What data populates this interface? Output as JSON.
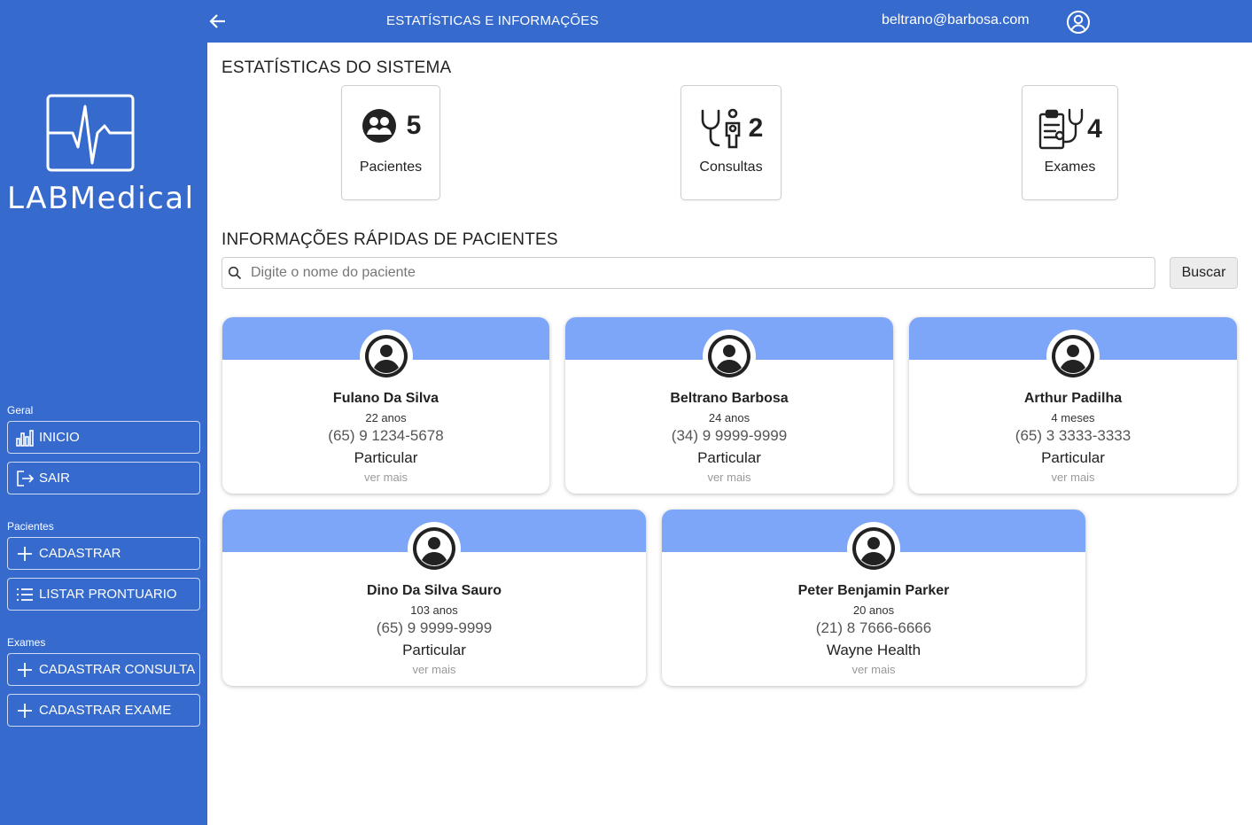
{
  "app": {
    "brand": "LABMedical"
  },
  "topbar": {
    "title": "ESTATÍSTICAS E INFORMAÇÕES",
    "email": "beltrano@barbosa.com"
  },
  "sidebar": {
    "sections": [
      {
        "label": "Geral",
        "items": [
          {
            "label": "INICIO",
            "icon": "bar-chart-icon"
          },
          {
            "label": "SAIR",
            "icon": "logout-icon"
          }
        ]
      },
      {
        "label": "Pacientes",
        "items": [
          {
            "label": "CADASTRAR",
            "icon": "plus-icon"
          },
          {
            "label": "LISTAR PRONTUARIO",
            "icon": "list-icon"
          }
        ]
      },
      {
        "label": "Exames",
        "items": [
          {
            "label": "CADASTRAR CONSULTA",
            "icon": "plus-icon"
          },
          {
            "label": "CADASTRAR EXAME",
            "icon": "plus-icon"
          }
        ]
      }
    ]
  },
  "stats": {
    "heading": "ESTATÍSTICAS DO SISTEMA",
    "items": [
      {
        "value": "5",
        "label": "Pacientes",
        "icon": "patients-icon"
      },
      {
        "value": "2",
        "label": "Consultas",
        "icon": "doctor-stethoscope-icon"
      },
      {
        "value": "4",
        "label": "Exames",
        "icon": "clipboard-stethoscope-icon"
      }
    ]
  },
  "quick": {
    "heading": "INFORMAÇÕES RÁPIDAS DE PACIENTES",
    "search_placeholder": "Digite o nome do paciente",
    "search_button": "Buscar"
  },
  "patients": [
    {
      "name": "Fulano Da Silva",
      "age": "22 anos",
      "phone": "(65) 9 1234-5678",
      "plan": "Particular",
      "more": "ver mais"
    },
    {
      "name": "Beltrano Barbosa",
      "age": "24 anos",
      "phone": "(34) 9 9999-9999",
      "plan": "Particular",
      "more": "ver mais"
    },
    {
      "name": "Arthur Padilha",
      "age": "4 meses",
      "phone": "(65) 3 3333-3333",
      "plan": "Particular",
      "more": "ver mais"
    },
    {
      "name": "Dino Da Silva Sauro",
      "age": "103 anos",
      "phone": "(65) 9 9999-9999",
      "plan": "Particular",
      "more": "ver mais"
    },
    {
      "name": "Peter Benjamin Parker",
      "age": "20 anos",
      "phone": "(21) 8 7666-6666",
      "plan": "Wayne Health",
      "more": "ver mais"
    }
  ],
  "colors": {
    "primary": "#366bcd",
    "card_band": "#7ea6f8"
  }
}
